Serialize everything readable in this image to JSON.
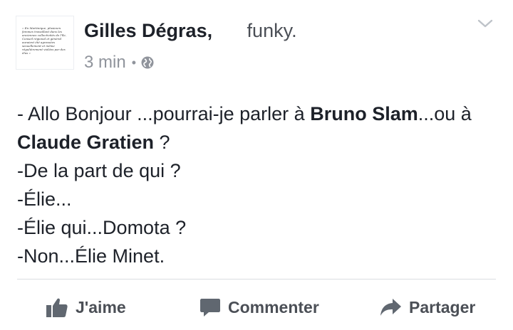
{
  "post": {
    "author": "Gilles Dégras,",
    "feeling": "funky.",
    "time": "3 min",
    "separator": "•",
    "lines": [
      [
        {
          "t": "- Allo Bonjour ...pourrai-je parler à ",
          "b": false
        },
        {
          "t": "Bruno Slam",
          "b": true
        },
        {
          "t": "...ou à ",
          "b": false
        },
        {
          "t": "Claude Gratien",
          "b": true
        },
        {
          "t": " ?",
          "b": false
        }
      ],
      [
        {
          "t": "-De la part de qui ?",
          "b": false
        }
      ],
      [
        {
          "t": "-Élie...",
          "b": false
        }
      ],
      [
        {
          "t": "-Élie qui...Domota ?",
          "b": false
        }
      ],
      [
        {
          "t": "-Non...Élie Minet.",
          "b": false
        }
      ]
    ]
  },
  "avatar": {
    "text": "« En Martinique, plusieurs femmes travaillant dans les anciennes collectivités de l'île, Conseil régional et général auraient été agressées sexuellement et même régulièrement violées par des élus »"
  },
  "actions": {
    "like": "J'aime",
    "comment": "Commenter",
    "share": "Partager"
  },
  "icons": {
    "privacy": "globe-icon",
    "menu": "chevron-down-icon",
    "like": "thumbs-up-icon",
    "comment": "comment-bubble-icon",
    "share": "share-arrow-icon"
  },
  "colors": {
    "text": "#1d2129",
    "secondary": "#90949c",
    "action": "#4b4f56",
    "divider": "#dadde1"
  }
}
